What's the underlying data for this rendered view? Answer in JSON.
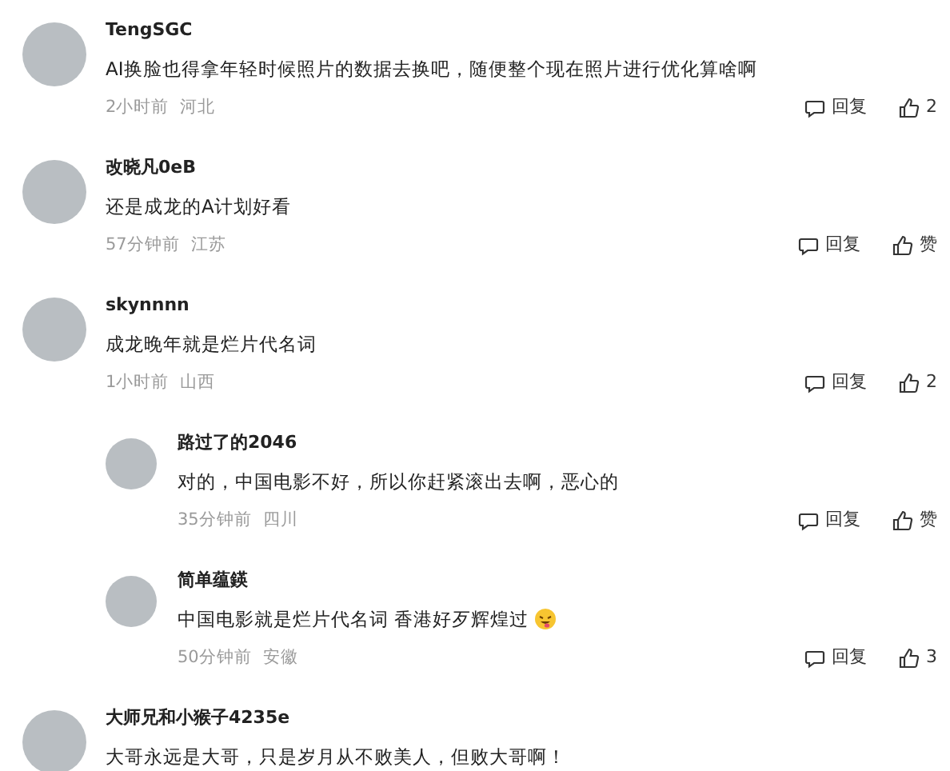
{
  "comments": [
    {
      "user": "TengSGC",
      "text": "AI换脸也得拿年轻时候照片的数据去换吧，随便整个现在照片进行优化算啥啊",
      "time": "2小时前",
      "location": "河北",
      "reply": "回复",
      "likes": "2"
    },
    {
      "user": "改晓凡0eB",
      "text": "还是成龙的A计划好看",
      "time": "57分钟前",
      "location": "江苏",
      "reply": "回复",
      "likes": "赞"
    },
    {
      "user": "skynnnn",
      "text": "成龙晚年就是烂片代名词",
      "time": "1小时前",
      "location": "山西",
      "reply": "回复",
      "likes": "2",
      "replies": [
        {
          "user": "路过了的2046",
          "text": "对的，中国电影不好，所以你赶紧滚出去啊，恶心的",
          "time": "35分钟前",
          "location": "四川",
          "reply": "回复",
          "likes": "赞",
          "emoji": false
        },
        {
          "user": "简单蕴鍈",
          "text": "中国电影就是烂片代名词 香港好歹辉煌过",
          "time": "50分钟前",
          "location": "安徽",
          "reply": "回复",
          "likes": "3",
          "emoji": true
        }
      ]
    },
    {
      "user": "大师兄和小猴子4235e",
      "text": "大哥永远是大哥，只是岁月从不败美人，但败大哥啊！"
    }
  ]
}
